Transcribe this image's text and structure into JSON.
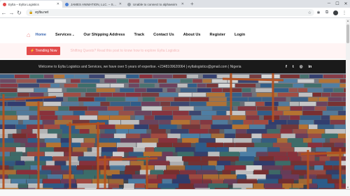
{
  "browser": {
    "tabs": [
      {
        "title": "Eylta – Eylta Logistics",
        "favicon_color": "#e24a4a",
        "active": true
      },
      {
        "title": "JAMES ANIMATION, LLC. – Smo",
        "favicon_color": "#4a7fd4",
        "active": false
      },
      {
        "title": "Unable to connect to alphaexim",
        "favicon_color": "#9aa0a6",
        "active": false
      }
    ],
    "new_tab": "+",
    "url": "eylta.net"
  },
  "nav": {
    "items": [
      {
        "label": "Home",
        "active": true
      },
      {
        "label": "Services",
        "dropdown": true
      },
      {
        "label": "Our Shipping Address"
      },
      {
        "label": "Track"
      },
      {
        "label": "Contact Us"
      },
      {
        "label": "About Us"
      },
      {
        "label": "Register"
      },
      {
        "label": "Login"
      }
    ]
  },
  "trending": {
    "button_label": "Trending Now",
    "headline": "Shifting Quests? Read this post to know how to explore Eylta Logistics"
  },
  "topbar": {
    "welcome": "Welcome to Eylta Logistics and Services, we have over 5 years of expertise. +2348109620064 | eyltalogistics@gmail.com | Nigeria",
    "socials": [
      {
        "name": "facebook-icon",
        "glyph": "f"
      },
      {
        "name": "twitter-icon",
        "glyph": "t"
      },
      {
        "name": "instagram-icon",
        "glyph": "◎"
      },
      {
        "name": "linkedin-icon",
        "glyph": "in"
      }
    ]
  },
  "colors": {
    "accent": "#e24a4a",
    "nav_active": "#3a66b0",
    "topbar_bg": "#1a1a1a"
  }
}
